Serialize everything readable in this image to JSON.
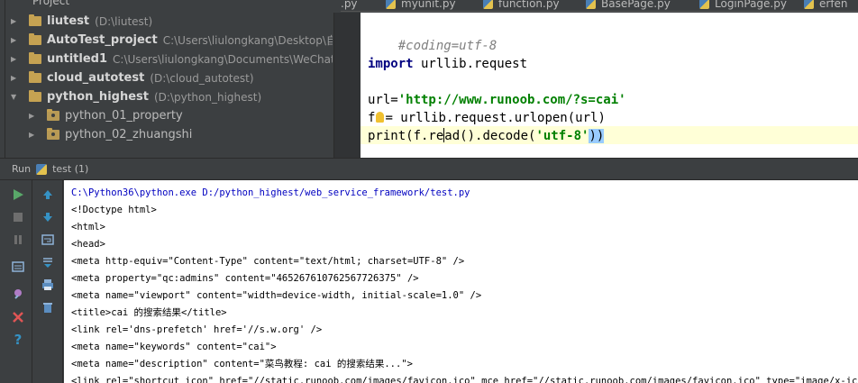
{
  "project_panel": {
    "header": "Project",
    "items": [
      {
        "name": "liutest",
        "path": "(D:\\liutest)",
        "kind": "folder"
      },
      {
        "name": "AutoTest_project",
        "path": "C:\\Users\\liulongkang\\Desktop\\自动",
        "kind": "folder"
      },
      {
        "name": "untitled1",
        "path": "C:\\Users\\liulongkang\\Documents\\WeChat F",
        "kind": "folder"
      },
      {
        "name": "cloud_autotest",
        "path": "(D:\\cloud_autotest)",
        "kind": "folder"
      },
      {
        "name": "python_highest",
        "path": "(D:\\python_highest)",
        "kind": "folder"
      },
      {
        "name": "python_01_property",
        "path": "",
        "kind": "package"
      },
      {
        "name": "python_02_zhuangshi",
        "path": "",
        "kind": "package"
      }
    ]
  },
  "tabs": [
    ".py",
    "myunit.py",
    "function.py",
    "BasePage.py",
    "LoginPage.py",
    "erfen"
  ],
  "editor": {
    "line1": "#coding=utf-8",
    "line2_kw": "import",
    "line2_rest": " urllib.request",
    "line3_a": "url=",
    "line3_str": "'http://www.runoob.com/?s=cai'",
    "line4_a": "f",
    "line4_b": "= urllib.request.urlopen(url)",
    "line5_a": "print(f.re",
    "line5_b": "ad().decode(",
    "line5_str": "'utf-8'",
    "line5_c": "))"
  },
  "run": {
    "label": "Run",
    "config": "test (1)"
  },
  "console": {
    "lines": [
      "C:\\Python36\\python.exe D:/python_highest/web_service_framework/test.py",
      "<!Doctype html>",
      "<html>",
      "<head>",
      "<meta http-equiv=\"Content-Type\" content=\"text/html; charset=UTF-8\" />",
      "<meta property=\"qc:admins\" content=\"465267610762567726375\" />",
      "<meta name=\"viewport\" content=\"width=device-width, initial-scale=1.0\" />",
      "<title>cai 的搜索结果</title>",
      "<link rel='dns-prefetch' href='//s.w.org' />",
      "<meta name=\"keywords\" content=\"cai\">",
      "<meta name=\"description\" content=\"菜鸟教程: cai 的搜索结果...\">",
      "<link rel=\"shortcut icon\" href=\"//static.runoob.com/images/favicon.ico\" mce_href=\"//static.runoob.com/images/favicon.ico\" type=\"image/x-icon\">"
    ]
  },
  "colors": {
    "panel_bg": "#3c3f41",
    "editor_bg": "#ffffff",
    "folder": "#c5a252",
    "string": "#008000",
    "keyword": "#000080",
    "comment": "#808080",
    "run_green": "#59a869",
    "stop_red": "#e05555",
    "help_blue": "#3592c4"
  }
}
